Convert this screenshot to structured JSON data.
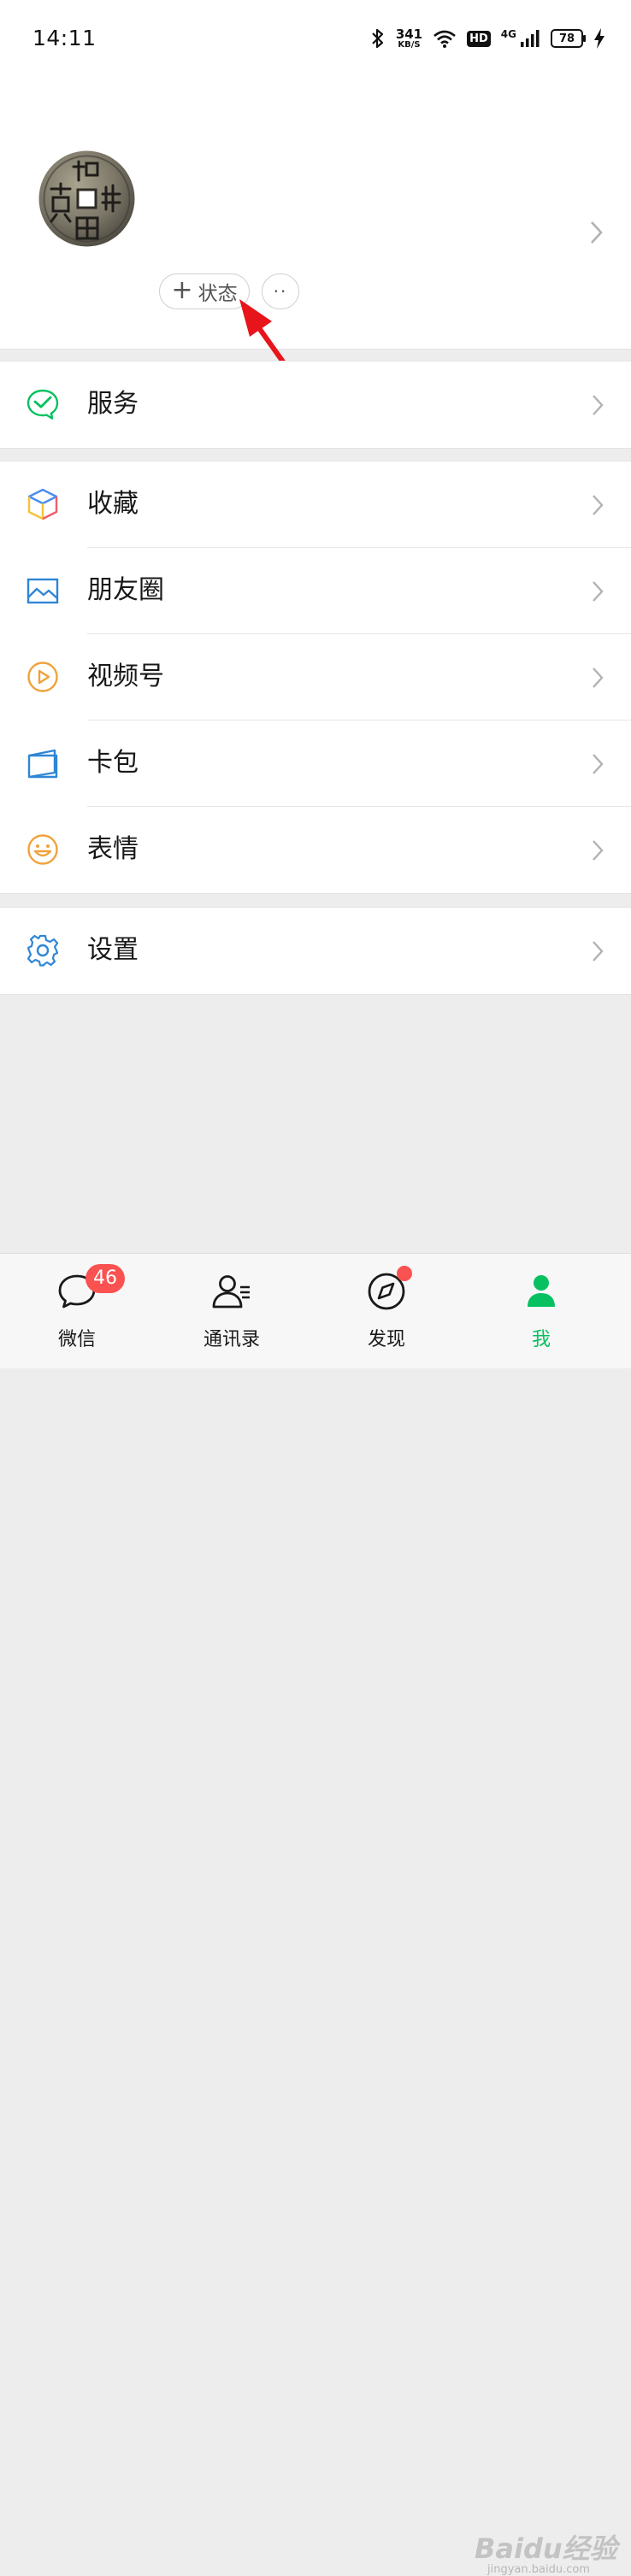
{
  "status_bar": {
    "time": "14:11",
    "net_speed": "341",
    "net_speed_unit": "KB/S",
    "hd": "HD",
    "network": "4G",
    "battery": "78"
  },
  "profile": {
    "status_button_label": "状态",
    "more_label": "··"
  },
  "menu": {
    "services": "服务",
    "favorites": "收藏",
    "moments": "朋友圈",
    "channels": "视频号",
    "cards": "卡包",
    "stickers": "表情",
    "settings": "设置"
  },
  "tabbar": {
    "chats": "微信",
    "chats_badge": "46",
    "contacts": "通讯录",
    "discover": "发现",
    "me": "我"
  },
  "watermark": {
    "brand": "Baidu经验",
    "url": "jingyan.baidu.com"
  },
  "colors": {
    "accent": "#07c160",
    "badge": "#fa5151",
    "annotation_arrow": "#e8141b"
  }
}
